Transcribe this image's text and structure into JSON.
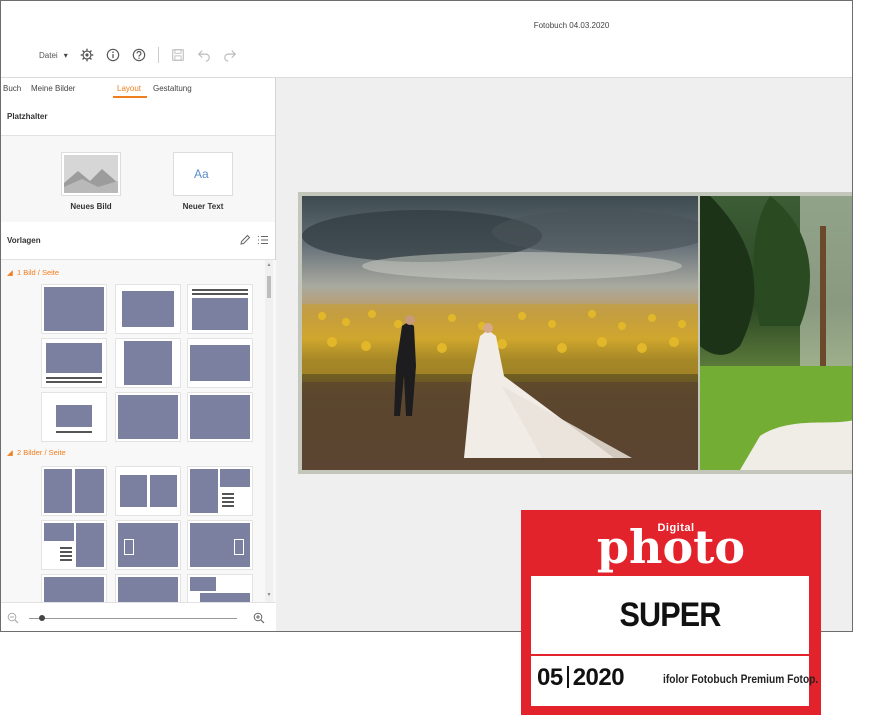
{
  "window": {
    "title": "Fotobuch 04.03.2020"
  },
  "toolbar": {
    "file_menu": "Datei",
    "dropdown_arrow": "▾",
    "icons": [
      "settings-gear-icon",
      "info-icon",
      "help-icon",
      "save-icon",
      "undo-icon",
      "redo-icon"
    ]
  },
  "sidebar": {
    "tabs": [
      {
        "label": "Buch"
      },
      {
        "label": "Meine Bilder"
      },
      {
        "label": "Layout",
        "active": true
      },
      {
        "label": "Gestaltung"
      }
    ],
    "placeholders": {
      "title": "Platzhalter",
      "items": [
        {
          "label": "Neues Bild"
        },
        {
          "label": "Neuer Text",
          "glyph": "Aa"
        }
      ]
    },
    "templates": {
      "title": "Vorlagen",
      "groups": [
        {
          "label": "1 Bild / Seite"
        },
        {
          "label": "2 Bilder / Seite"
        }
      ]
    }
  },
  "badge": {
    "magazine_small": "Digital",
    "magazine": "photo",
    "rating": "SUPER",
    "issue_number": "05",
    "issue_year": "2020",
    "product": "ifolor Fotobuch Premium Fotop.",
    "color": "#e3232b"
  },
  "colors": {
    "accent": "#f07d1e",
    "template_fill": "#7b80a0"
  }
}
